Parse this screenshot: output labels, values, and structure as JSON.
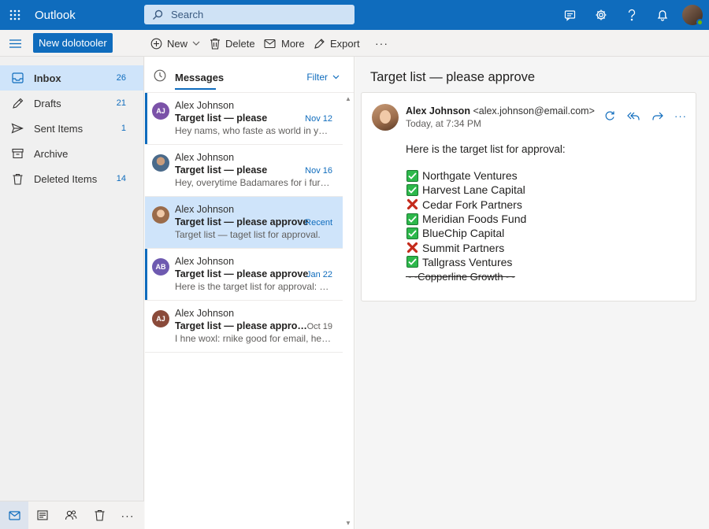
{
  "app": {
    "title": "Outlook"
  },
  "search": {
    "placeholder": "Search"
  },
  "toolbar": {
    "new_mail": "New dolotooler",
    "new": "New",
    "delete": "Delete",
    "more": "More",
    "export": "Export",
    "overflow": "···"
  },
  "folders": [
    {
      "label": "Inbox",
      "count": "26",
      "icon": "inbox-icon"
    },
    {
      "label": "Drafts",
      "count": "21",
      "icon": "pencil-icon"
    },
    {
      "label": "Sent Items",
      "count": "1",
      "icon": "send-icon"
    },
    {
      "label": "Archive",
      "count": "",
      "icon": "archive-icon"
    },
    {
      "label": "Deleted Items",
      "count": "14",
      "icon": "trash-icon"
    }
  ],
  "bottom_nav": {
    "overflow": "···"
  },
  "list": {
    "title": "Messages",
    "filter": "Filter",
    "messages": [
      {
        "initials": "AJ",
        "from": "Alex Johnson",
        "subject": "Target list — please",
        "date": "Nov 12",
        "preview": "Hey nams, who faste as world in you ...",
        "unread": true,
        "avatar_color": "#7b52a8"
      },
      {
        "initials": "",
        "from": "Alex Johnson",
        "subject": "Target list — please",
        "date": "Nov 16",
        "preview": "Hey, overytime Badamares for i furne...",
        "unread": false,
        "avatar_color": "#5c4a3a"
      },
      {
        "initials": "",
        "from": "Alex Johnson",
        "subject": "Target list — please approve",
        "date": "Recent",
        "preview": "Target list — taget list for approval.",
        "unread": false,
        "avatar_color": "#b07a56"
      },
      {
        "initials": "AB",
        "from": "Alex Johnson",
        "subject": "Target list — please approve",
        "date": "Jan 22",
        "preview": "Here is the target list for approval: Fiir...",
        "unread": true,
        "avatar_color": "#6e5ab0"
      },
      {
        "initials": "AJ",
        "from": "Alex Johnson",
        "subject": "Target list — please approve...",
        "date": "Oct 19",
        "preview": "I hne woxl: rnike good for email, here...",
        "unread": false,
        "avatar_color": "#8a4a3a"
      }
    ]
  },
  "reading": {
    "subject": "Target list — please approve",
    "sender_name": "Alex Johnson",
    "sender_email": "<alex.johnson@email.com>",
    "time": "Today, at 7:34 PM",
    "intro": "Here is the target list for approval:",
    "items": [
      {
        "label": "Northgate Ventures",
        "status": "approved"
      },
      {
        "label": "Harvest Lane Capital",
        "status": "approved"
      },
      {
        "label": "Cedar Fork Partners",
        "status": "rejected"
      },
      {
        "label": "Meridian Foods Fund",
        "status": "approved"
      },
      {
        "label": "BlueChip Capital",
        "status": "approved"
      },
      {
        "label": "Summit Partners",
        "status": "rejected"
      },
      {
        "label": "Tallgrass Ventures",
        "status": "approved"
      },
      {
        "label": "~~Copperline Growth~~",
        "status": "struck"
      }
    ]
  },
  "colors": {
    "brand": "#0f6cbd",
    "approved": "#2db84b",
    "rejected": "#c42b1c",
    "selected": "#cfe4fa"
  }
}
